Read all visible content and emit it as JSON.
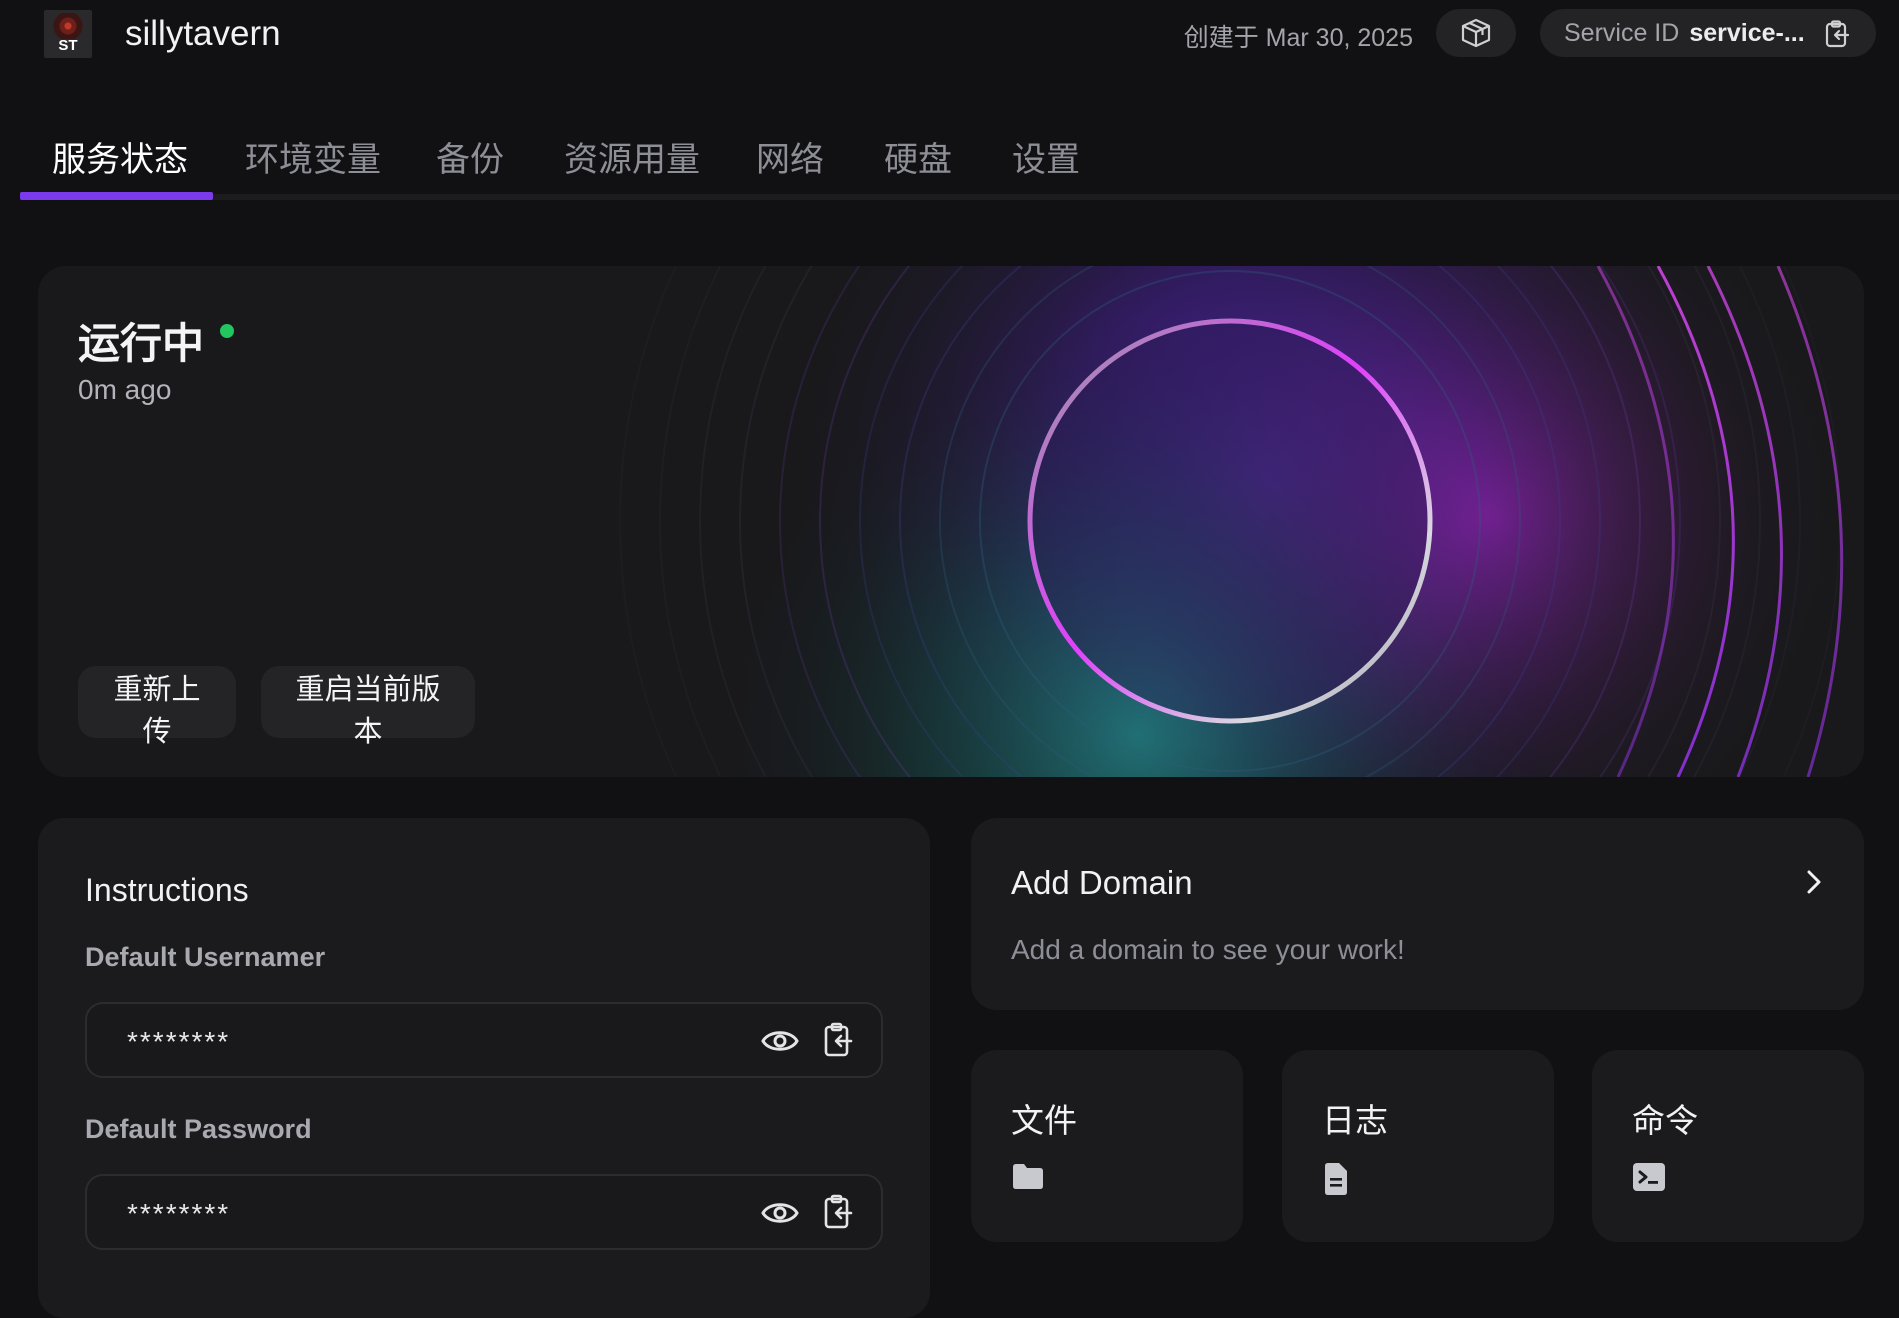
{
  "header": {
    "logo_text": "ST",
    "app_name": "sillytavern",
    "created_label": "创建于 Mar 30, 2025",
    "service_id_label": "Service ID",
    "service_id_value": "service-..."
  },
  "tabs": [
    {
      "label": "服务状态",
      "active": true
    },
    {
      "label": "环境变量",
      "active": false
    },
    {
      "label": "备份",
      "active": false
    },
    {
      "label": "资源用量",
      "active": false
    },
    {
      "label": "网络",
      "active": false
    },
    {
      "label": "硬盘",
      "active": false
    },
    {
      "label": "设置",
      "active": false
    }
  ],
  "status": {
    "title": "运行中",
    "time": "0m ago",
    "dot_color": "#22c55e",
    "reupload_label": "重新上传",
    "restart_label": "重启当前版本"
  },
  "instructions": {
    "title": "Instructions",
    "username_label": "Default Usernamer",
    "username_value": "********",
    "password_label": "Default Password",
    "password_value": "********"
  },
  "domain": {
    "title": "Add Domain",
    "subtitle": "Add a domain to see your work!"
  },
  "shortcuts": {
    "files": {
      "label": "文件",
      "icon": "folder-icon"
    },
    "logs": {
      "label": "日志",
      "icon": "document-icon"
    },
    "commands": {
      "label": "命令",
      "icon": "terminal-icon"
    }
  },
  "colors": {
    "accent": "#7c3aed",
    "background": "#111113",
    "card": "#1b1b1e"
  }
}
